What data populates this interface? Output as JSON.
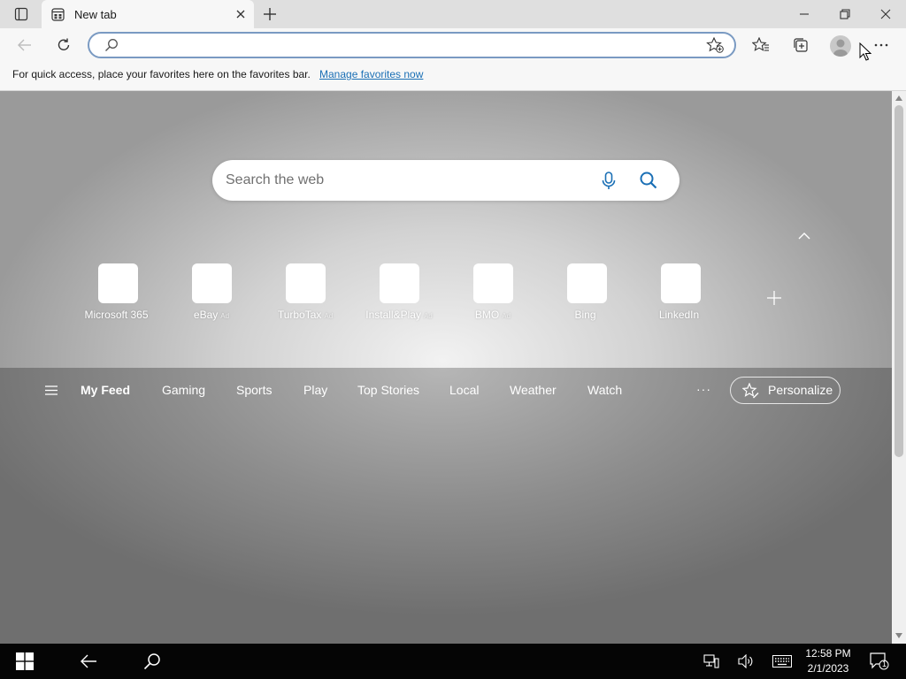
{
  "tab": {
    "title": "New tab"
  },
  "address_bar": {
    "value": "",
    "placeholder": ""
  },
  "favorites_bar": {
    "message": "For quick access, place your favorites here on the favorites bar.",
    "link": "Manage favorites now"
  },
  "search": {
    "placeholder": "Search the web"
  },
  "tiles": [
    {
      "label": "Microsoft 365",
      "ad": ""
    },
    {
      "label": "eBay",
      "ad": "Ad"
    },
    {
      "label": "TurboTax",
      "ad": "Ad"
    },
    {
      "label": "Install&Play",
      "ad": "Ad"
    },
    {
      "label": "BMO",
      "ad": "Ad"
    },
    {
      "label": "Bing",
      "ad": ""
    },
    {
      "label": "LinkedIn",
      "ad": ""
    }
  ],
  "feed_nav": {
    "items": [
      "My Feed",
      "Gaming",
      "Sports",
      "Play",
      "Top Stories",
      "Local",
      "Weather",
      "Watch"
    ],
    "more": "···",
    "personalize": "Personalize"
  },
  "taskbar": {
    "time": "12:58 PM",
    "date": "2/1/2023",
    "notification_count": "1"
  },
  "colors": {
    "link": "#1a6fb5",
    "accent_icon": "#1a6fb5",
    "address_border": "#7a9ac2",
    "taskbar": "#050505"
  },
  "icons": [
    "tab-actions-icon",
    "newtab-favicon",
    "close-icon",
    "plus-icon",
    "minimize-icon",
    "restore-icon",
    "window-close-icon",
    "back-arrow-icon",
    "refresh-icon",
    "search-icon",
    "add-favorite-icon",
    "favorites-icon",
    "collections-icon",
    "profile-icon",
    "more-icon",
    "microphone-icon",
    "chevron-up-icon",
    "hamburger-icon",
    "personalize-icon",
    "windows-start-icon",
    "network-icon",
    "volume-icon",
    "keyboard-icon",
    "notification-icon"
  ]
}
